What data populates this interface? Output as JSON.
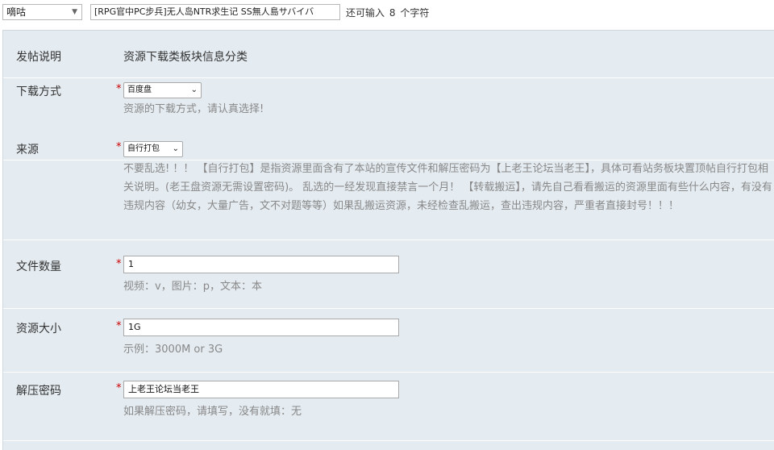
{
  "header": {
    "type_select": "嘀咕",
    "title_value": "[RPG官中PC步兵]无人岛NTR求生记 SS無人島サバイバ",
    "char_hint_prefix": "还可输入",
    "char_hint_count": "8",
    "char_hint_suffix": "个字符"
  },
  "form": {
    "intro": {
      "label": "发帖说明",
      "value": "资源下载类板块信息分类"
    },
    "download": {
      "label": "下载方式",
      "selected": "百度盘",
      "tip": "资源的下载方式，请认真选择!"
    },
    "source": {
      "label": "来源",
      "selected": "自行打包",
      "tip": "不要乱选! ！！ 【自行打包】是指资源里面含有了本站的宣传文件和解压密码为【上老王论坛当老王】，具体可看站务板块置顶帖自行打包相关说明。(老王盘资源无需设置密码)。 乱选的一经发现直接禁言一个月！ 【转载搬运】，请先自己看看搬运的资源里面有些什么内容，有没有违规内容（幼女，大量广告，文不对题等等）如果乱搬运资源，未经检查乱搬运，查出违规内容，严重者直接封号！！！"
    },
    "file_count": {
      "label": "文件数量",
      "value": "1",
      "tip": "视频：v，图片：p，文本：本"
    },
    "size": {
      "label": "资源大小",
      "value": "1G",
      "tip": "示例：3000M or 3G"
    },
    "password": {
      "label": "解压密码",
      "value": "上老王论坛当老王",
      "tip": "如果解压密码，请填写，没有就填：无"
    },
    "required_mark": "*"
  }
}
